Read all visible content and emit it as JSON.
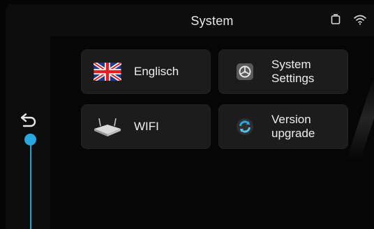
{
  "header": {
    "title": "System"
  },
  "tiles": [
    {
      "label": "Englisch",
      "icon": "uk-flag-icon"
    },
    {
      "label": "System\nSettings",
      "icon": "steering-wheel-settings-icon"
    },
    {
      "label": "WIFI",
      "icon": "router-icon"
    },
    {
      "label": "Version\nupgrade",
      "icon": "refresh-upgrade-icon"
    }
  ],
  "status_icons": [
    "storage-icon",
    "wifi-icon"
  ],
  "colors": {
    "accent": "#2aa7e0",
    "tile": "#1c1c1c",
    "background": "#050505"
  }
}
